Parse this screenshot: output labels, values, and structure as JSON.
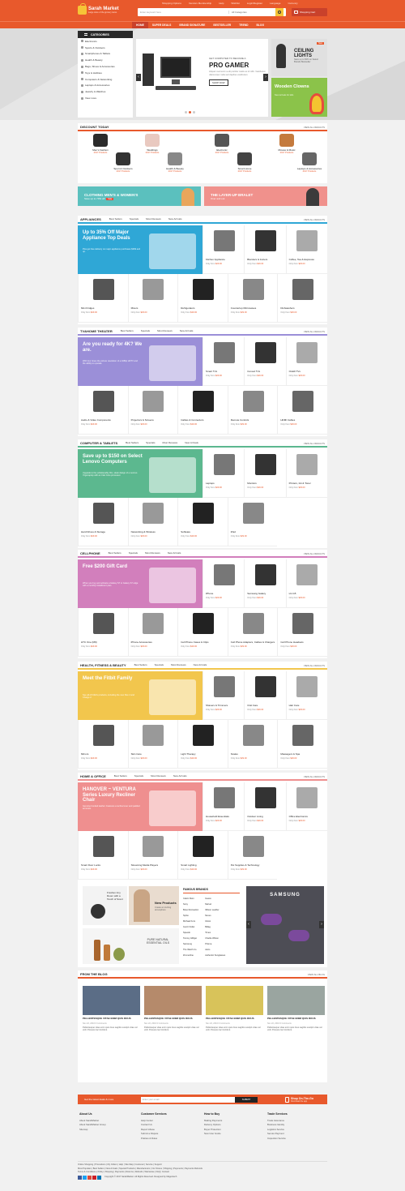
{
  "colors": {
    "accent": "#e8592c",
    "dark_accent": "#c9412b",
    "yellow": "#f6c437",
    "green": "#8bc34a"
  },
  "header": {
    "top_links": [
      "Shopping Options",
      "Vendors Membership",
      "Help",
      "Wishlist",
      "Login/Register",
      "Language",
      "Currency"
    ],
    "logo_name": "Sarah Market",
    "logo_tagline": "Large store of the grocery items",
    "search_placeholder": "Enter keyword here",
    "search_category": "All Categories",
    "cart_label": "Shopping Cart",
    "nav": [
      "HOME",
      "SUPER DEALS",
      "BRAND SIGNATURE",
      "BESTSELLER",
      "TREND",
      "BLOG"
    ]
  },
  "sidebar": {
    "title": "CATEGORIES",
    "items": [
      "Electronics",
      "Sports & Outdoors",
      "Smartphones & Tablets",
      "Health & Beauty",
      "Bags, Shoes & Accessories",
      "Toys & Hobbies",
      "Computers & Networking",
      "Laptops & Accessories",
      "Jewelry & Watches",
      "View more"
    ]
  },
  "hero": {
    "subtitle": "GET COMPUTER TO BECOME A",
    "title": "PRO GAMER",
    "description": "Aliquam sed enim a elit porttitor mattis ac id nibh. Vestibulum ullamcorper nulla sed dapibus vestibulum.",
    "button": "SHOP NOW",
    "promo_a_badge": "New",
    "promo_a_title": "CEILING LIGHTS",
    "promo_a_sub": "Save up to 50% on Select Brands Bestseller",
    "promo_b_title": "Wooden Clowns",
    "promo_b_sub": "New arrivals for kids",
    "slide_dots": 3,
    "active_dot": 2
  },
  "discount": {
    "title": "DISCOUNT TODAY",
    "view_all": "VIEW ALL RESULTS",
    "items": [
      {
        "name": "Men's Fashion",
        "count": "2017 Products"
      },
      {
        "name": "Weddings",
        "count": "2017 Products"
      },
      {
        "name": "Electronic",
        "count": "2017 Products"
      },
      {
        "name": "Movies & Music",
        "count": "2017 Products"
      },
      {
        "name": "Sport & Outdoors",
        "count": "2017 Products"
      },
      {
        "name": "Health & Beauty",
        "count": "2017 Products"
      },
      {
        "name": "Smart Home",
        "count": "2017 Products"
      },
      {
        "name": "Laptops & Accessories",
        "count": "2017 Products"
      }
    ]
  },
  "banners": {
    "left_title": "CLOTHING MEN'S & WOMEN'S",
    "left_sub": "Save up to 70% off",
    "left_tag": "Sale",
    "right_title": "THE LAYER-UP BRALET",
    "right_sub": "Over and out"
  },
  "tabs": [
    "Best Sellers",
    "Specials",
    "Most Reviews",
    "New Arrivals"
  ],
  "price_prefix": "Only from",
  "price_value": "$29.00",
  "sections": [
    {
      "title": "APPLIANCES",
      "feat_title": "Up to 35% Off Major Appliance Top Deals",
      "feat_desc": "Plus get free delivery on major appliance purchases $399 and up.",
      "products": [
        "Kitchen Appliance",
        "Blenders & Juicers",
        "Coffee, Tea & Espresso",
        "Mini Fridges",
        "Mixers",
        "Refrigerators",
        "Countertop Microwaves",
        "Dishwashers"
      ]
    },
    {
      "title": "TV&HOME THEATER",
      "feat_title": "Are you ready for 4K? We are.",
      "feat_desc": "With four times the picture resolution of a 1080p HDTV and the ability to upscale.",
      "products": [
        "Smart TVs",
        "Curved TVs",
        "OLED TVs",
        "Audio & Video Components",
        "Projectors & Screens",
        "Cables & Connectors",
        "Remote Controls",
        "HDMI Cables"
      ]
    },
    {
      "title": "COMPUTER & TABLETS",
      "feat_title": "Save up to $150 on Select Lenovo Computers",
      "feat_desc": "Upgrade to the unbelievably thin, sleek design of a Lenovo Yoga laptop with an Intel Core processor.",
      "products": [
        "Laptops",
        "Monitors",
        "Printers, Ink & Toner",
        "Hard Drives & Storage",
        "Networking & Wireless",
        "Software",
        "iPad"
      ]
    },
    {
      "title": "CELLPHONE",
      "feat_title": "Free $200 Gift Card",
      "feat_desc": "When you buy and activate a Galaxy S7 or Galaxy S7 edge with a monthly installment plan.",
      "products": [
        "iPhone",
        "Samsung Galaxy",
        "LG G5",
        "HTC One (M9)",
        "iPhone Accessories",
        "Cell Phone Cases & Clips",
        "Cell Phone Adapters, Cables & Chargers",
        "Cell Phone Headsets"
      ]
    },
    {
      "title": "HEALTH, FITNESS & BEAUTY",
      "feat_title": "Meet the Fitbit Family",
      "feat_desc": "See all of Fitbit's products, including the new Flex 2 and Charge 2.",
      "products": [
        "Shavers & Trimmers",
        "Oral Care",
        "Hair Care",
        "Mirrors",
        "Skin Care",
        "Light Therapy",
        "Scales",
        "Massagers & Spa"
      ]
    },
    {
      "title": "HOME & OFFICE",
      "feat_title": "HANOVER ~ VENTURA Series Luxury Recliner Chair",
      "feat_desc": "Genuine bonded leather. Features a recline lever and padded armrests.",
      "products": [
        "Household Essentials",
        "Outdoor Living",
        "Office Electronics",
        "Smart Door Locks",
        "Streaming Media Players",
        "Smart Lighting",
        "Pet Supplies & Technology"
      ]
    }
  ],
  "brands": {
    "promo1_title": "Freshen Any Room with a Touch of Scent",
    "promo2_title": "New Products",
    "promo2_sub": "Create an inviting atmosphere",
    "promo3_title": "PURE NATURAL ESSENTIAL OILS",
    "title": "FAMOUS BRANDS",
    "col1": [
      "Calvin Klein",
      "Sony",
      "Bose Recreation",
      "Sprite",
      "Michael Kors",
      "Gucci Outlet",
      "Speedo",
      "Tommy Hilfiger",
      "Samsung",
      "The Watch Co",
      "Zimmerline"
    ],
    "col2": [
      "Guess",
      "Marvel",
      "Wilson Leather",
      "Nexus",
      "Ghost",
      "Bidag",
      "Timex",
      "Charlie Wilson",
      "Prisma",
      "Asics",
      "Authentic Sunglasses"
    ],
    "ad_brand": "SAMSUNG"
  },
  "blog": {
    "title": "FROM THE BLOG",
    "view_all": "VIEW ALL BLOG",
    "posts": [
      {
        "title": "PELLENTESQUE VITAE ENIM QUIS ROUS",
        "meta": "Nov 22, 2016  0 Comments",
        "desc": "Pellentesque vitae enim quis risus sagittis suscipit vitae vel velit. Posuere lac tincidunt."
      },
      {
        "title": "PELLENTESQUE VITAE ENIM QUIS ROUS",
        "meta": "Nov 22, 2016  0 Comments",
        "desc": "Pellentesque vitae enim quis risus sagittis suscipit vitae vel velit. Posuere lac tincidunt."
      },
      {
        "title": "PELLENTESQUE VITAE ENIM QUIS ROUS",
        "meta": "Nov 22, 2016  0 Comments",
        "desc": "Pellentesque vitae enim quis risus sagittis suscipit vitae vel velit. Posuere lac tincidunt."
      },
      {
        "title": "PELLENTESQUE VITAE ENIM QUIS ROUS",
        "meta": "Nov 22, 2016  0 Comments",
        "desc": "Pellentesque vitae enim quis risus sagittis suscipit vitae vel velit. Posuere lac tincidunt."
      }
    ]
  },
  "newsletter": {
    "label": "Get the latest deals & more",
    "placeholder": "Enter your email",
    "button": "SUBMIT",
    "app_title": "Shop On-The-Go",
    "app_sub": "Download the app"
  },
  "footer": {
    "col1": {
      "title": "About Us",
      "items": [
        "About SarahMarket",
        "About SarahMarket Group",
        "Sitemap"
      ]
    },
    "col2": {
      "title": "Customer Services",
      "items": [
        "Help Center",
        "Contact Us",
        "Report Abuse",
        "Submit a Dispute",
        "Policies & Rules"
      ]
    },
    "col3": {
      "title": "How to Buy",
      "items": [
        "Making Payments",
        "Delivery Options",
        "Buyer Protection",
        "New User Guide"
      ]
    },
    "col4": {
      "title": "Trade Services",
      "items": [
        "Trade Assurance",
        "Business Identity",
        "Logistics Service",
        "Secure Payment",
        "Inspection Service"
      ]
    },
    "links1": "Online Shopping  |  Promotions  |  My Orders  |  Help  |  Site Map  |  Customer  |  Service  |  Support",
    "links2": "Most Populars  |  Best Sellers  |  New Arrivals  |  Special Products  |  Manufacturers  |  Our Stores  |  Shipping  |  Payments  |  Payments  Refunds",
    "links3": "Terms & Conditions  |  Policy  |  Shipping  |  Payments  |  Returns  |  Refunds  |  Warrantee  |  FAQ  |  Contact",
    "copyright": "Copyright © 2017 SarahMarket. All Rights Reserved. Designed by Magentech"
  }
}
